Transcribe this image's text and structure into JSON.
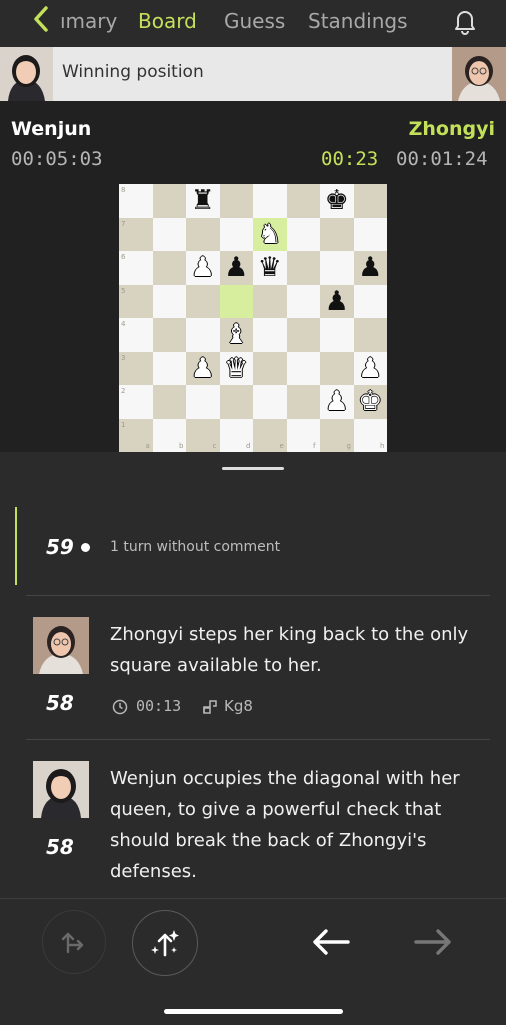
{
  "nav": {
    "tabs": [
      "ımary",
      "Board",
      "Guess",
      "Standings"
    ],
    "active_tab": "Board"
  },
  "banner": {
    "text": "Winning position"
  },
  "players": {
    "white": {
      "name": "Wenjun",
      "clock": "00:05:03"
    },
    "black": {
      "name": "Zhongyi",
      "move_time": "00:23",
      "clock": "00:01:24"
    }
  },
  "board": {
    "files": [
      "a",
      "b",
      "c",
      "d",
      "e",
      "f",
      "g",
      "h"
    ],
    "ranks": [
      "8",
      "7",
      "6",
      "5",
      "4",
      "3",
      "2",
      "1"
    ],
    "highlights": [
      "e7",
      "d5"
    ],
    "pieces": [
      {
        "sq": "c8",
        "glyph": "♜",
        "color": "black",
        "name": "black-rook"
      },
      {
        "sq": "g8",
        "glyph": "♚",
        "color": "black",
        "name": "black-king"
      },
      {
        "sq": "e7",
        "glyph": "♞",
        "color": "white",
        "name": "white-knight"
      },
      {
        "sq": "c6",
        "glyph": "♟",
        "color": "white",
        "name": "white-pawn"
      },
      {
        "sq": "d6",
        "glyph": "♟",
        "color": "black",
        "name": "black-pawn"
      },
      {
        "sq": "e6",
        "glyph": "♛",
        "color": "black",
        "name": "black-queen"
      },
      {
        "sq": "h6",
        "glyph": "♟",
        "color": "black",
        "name": "black-pawn"
      },
      {
        "sq": "g5",
        "glyph": "♟",
        "color": "black",
        "name": "black-pawn"
      },
      {
        "sq": "d4",
        "glyph": "♝",
        "color": "white",
        "name": "white-bishop"
      },
      {
        "sq": "c3",
        "glyph": "♟",
        "color": "white",
        "name": "white-pawn"
      },
      {
        "sq": "d3",
        "glyph": "♛",
        "color": "white",
        "name": "white-queen"
      },
      {
        "sq": "h3",
        "glyph": "♟",
        "color": "white",
        "name": "white-pawn"
      },
      {
        "sq": "g2",
        "glyph": "♟",
        "color": "white",
        "name": "white-pawn"
      },
      {
        "sq": "h2",
        "glyph": "♚",
        "color": "white",
        "name": "white-king"
      }
    ]
  },
  "feed": {
    "collapsed": {
      "move": "59",
      "text": "1 turn without comment"
    },
    "items": [
      {
        "move": "58",
        "text": "Zhongyi steps her king back to the only square available to her.",
        "time": "00:13",
        "san": "Kg8"
      },
      {
        "move": "58",
        "text": "Wenjun occupies the diagonal with her queen, to give a powerful check that should break the back of Zhongyi's defenses."
      }
    ]
  },
  "colors": {
    "accent": "#c3e05a",
    "light_square": "#f7f7f7",
    "dark_square": "#d8d2c1",
    "highlight": "#d8ee9f"
  },
  "icons": {
    "back": "chevron-left-icon",
    "bell": "bell-icon",
    "clock": "clock-icon",
    "move": "move-icon",
    "suggest": "arrow-branch-icon",
    "magic": "sparkle-arrow-icon",
    "prev": "arrow-left-icon",
    "next": "arrow-right-icon"
  }
}
